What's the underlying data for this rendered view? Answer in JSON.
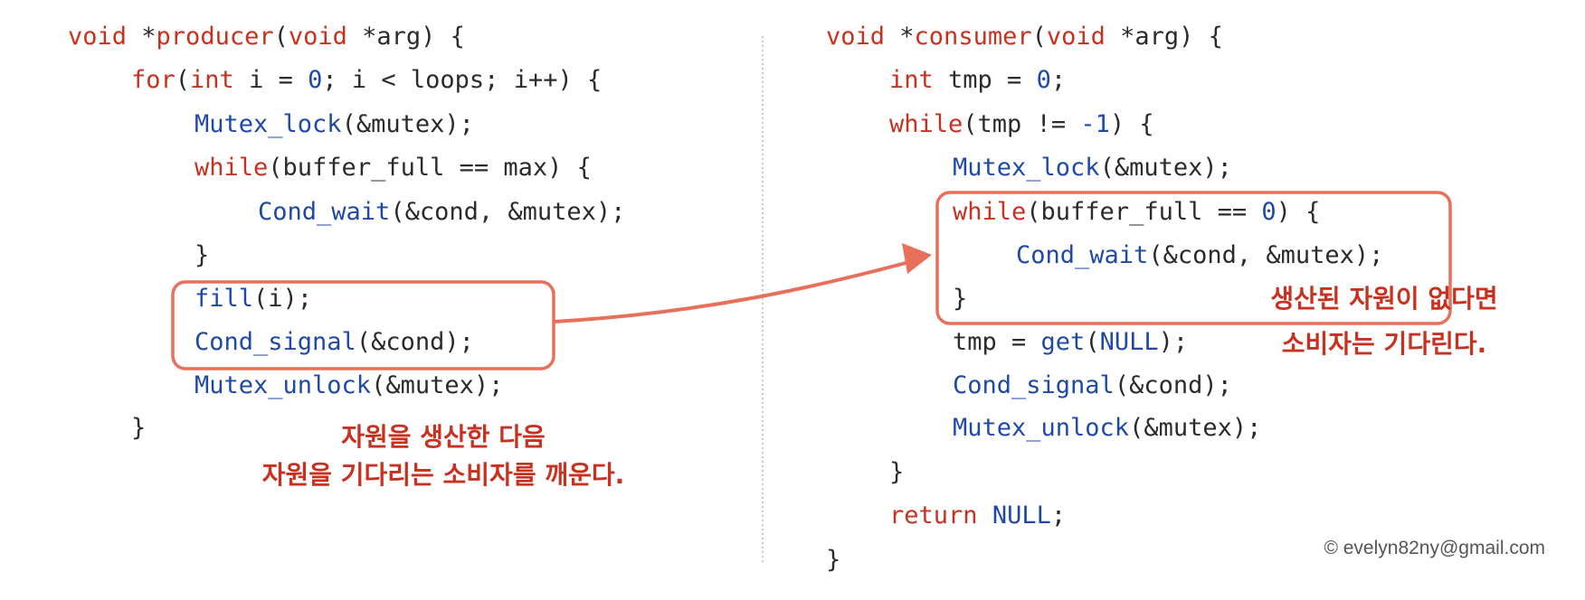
{
  "producer": {
    "l1": {
      "kw": "void",
      "ptr": " *",
      "fn": "producer",
      "p1": "(",
      "kw2": "void",
      "rest": " *arg) {"
    },
    "l2": {
      "kw": "for",
      "p1": "(",
      "kw2": "int",
      "a": " i = ",
      "num": "0",
      "b": "; i < loops; i++) {"
    },
    "l3": {
      "fn": "Mutex_lock",
      "rest": "(&mutex);"
    },
    "l4": {
      "kw": "while",
      "rest": "(buffer_full == max) {"
    },
    "l5": {
      "fn": "Cond_wait",
      "rest": "(&cond, &mutex);"
    },
    "l6": "}",
    "l7": {
      "fn": "fill",
      "rest": "(i);"
    },
    "l8": {
      "fn": "Cond_signal",
      "rest": "(&cond);"
    },
    "l9": {
      "fn": "Mutex_unlock",
      "rest": "(&mutex);"
    },
    "l10": "}"
  },
  "consumer": {
    "l1": {
      "kw": "void",
      "ptr": " *",
      "fn": "consumer",
      "p1": "(",
      "kw2": "void",
      "rest": " *arg) {"
    },
    "l2": {
      "kw": "int",
      "a": " tmp = ",
      "num": "0",
      "b": ";"
    },
    "l3": {
      "kw": "while",
      "a": "(tmp != ",
      "num": "-1",
      "b": ") {"
    },
    "l4": {
      "fn": "Mutex_lock",
      "rest": "(&mutex);"
    },
    "l5": {
      "kw": "while",
      "a": "(buffer_full == ",
      "num": "0",
      "b": ") {"
    },
    "l6": {
      "fn": "Cond_wait",
      "rest": "(&cond, &mutex);"
    },
    "l7": "}",
    "l8": {
      "a": "tmp = ",
      "fn": "get",
      "p1": "(",
      "arg": "NULL",
      "b": ");"
    },
    "l9": {
      "fn": "Cond_signal",
      "rest": "(&cond);"
    },
    "l10": {
      "fn": "Mutex_unlock",
      "rest": "(&mutex);"
    },
    "l11": "}",
    "l12": {
      "kw": "return",
      "sp": " ",
      "arg": "NULL",
      "b": ";"
    },
    "l13": "}"
  },
  "annotations": {
    "producer_line1": "자원을 생산한 다음",
    "producer_line2": "자원을 기다리는 소비자를 깨운다.",
    "consumer_line1": "생산된 자원이 없다면",
    "consumer_line2": "소비자는 기다린다."
  },
  "copyright": "© evelyn82ny@gmail.com",
  "colors": {
    "keyword": "#c8311f",
    "function": "#1f49a8",
    "annotation": "#c8311f",
    "highlight": "#e8705a"
  }
}
